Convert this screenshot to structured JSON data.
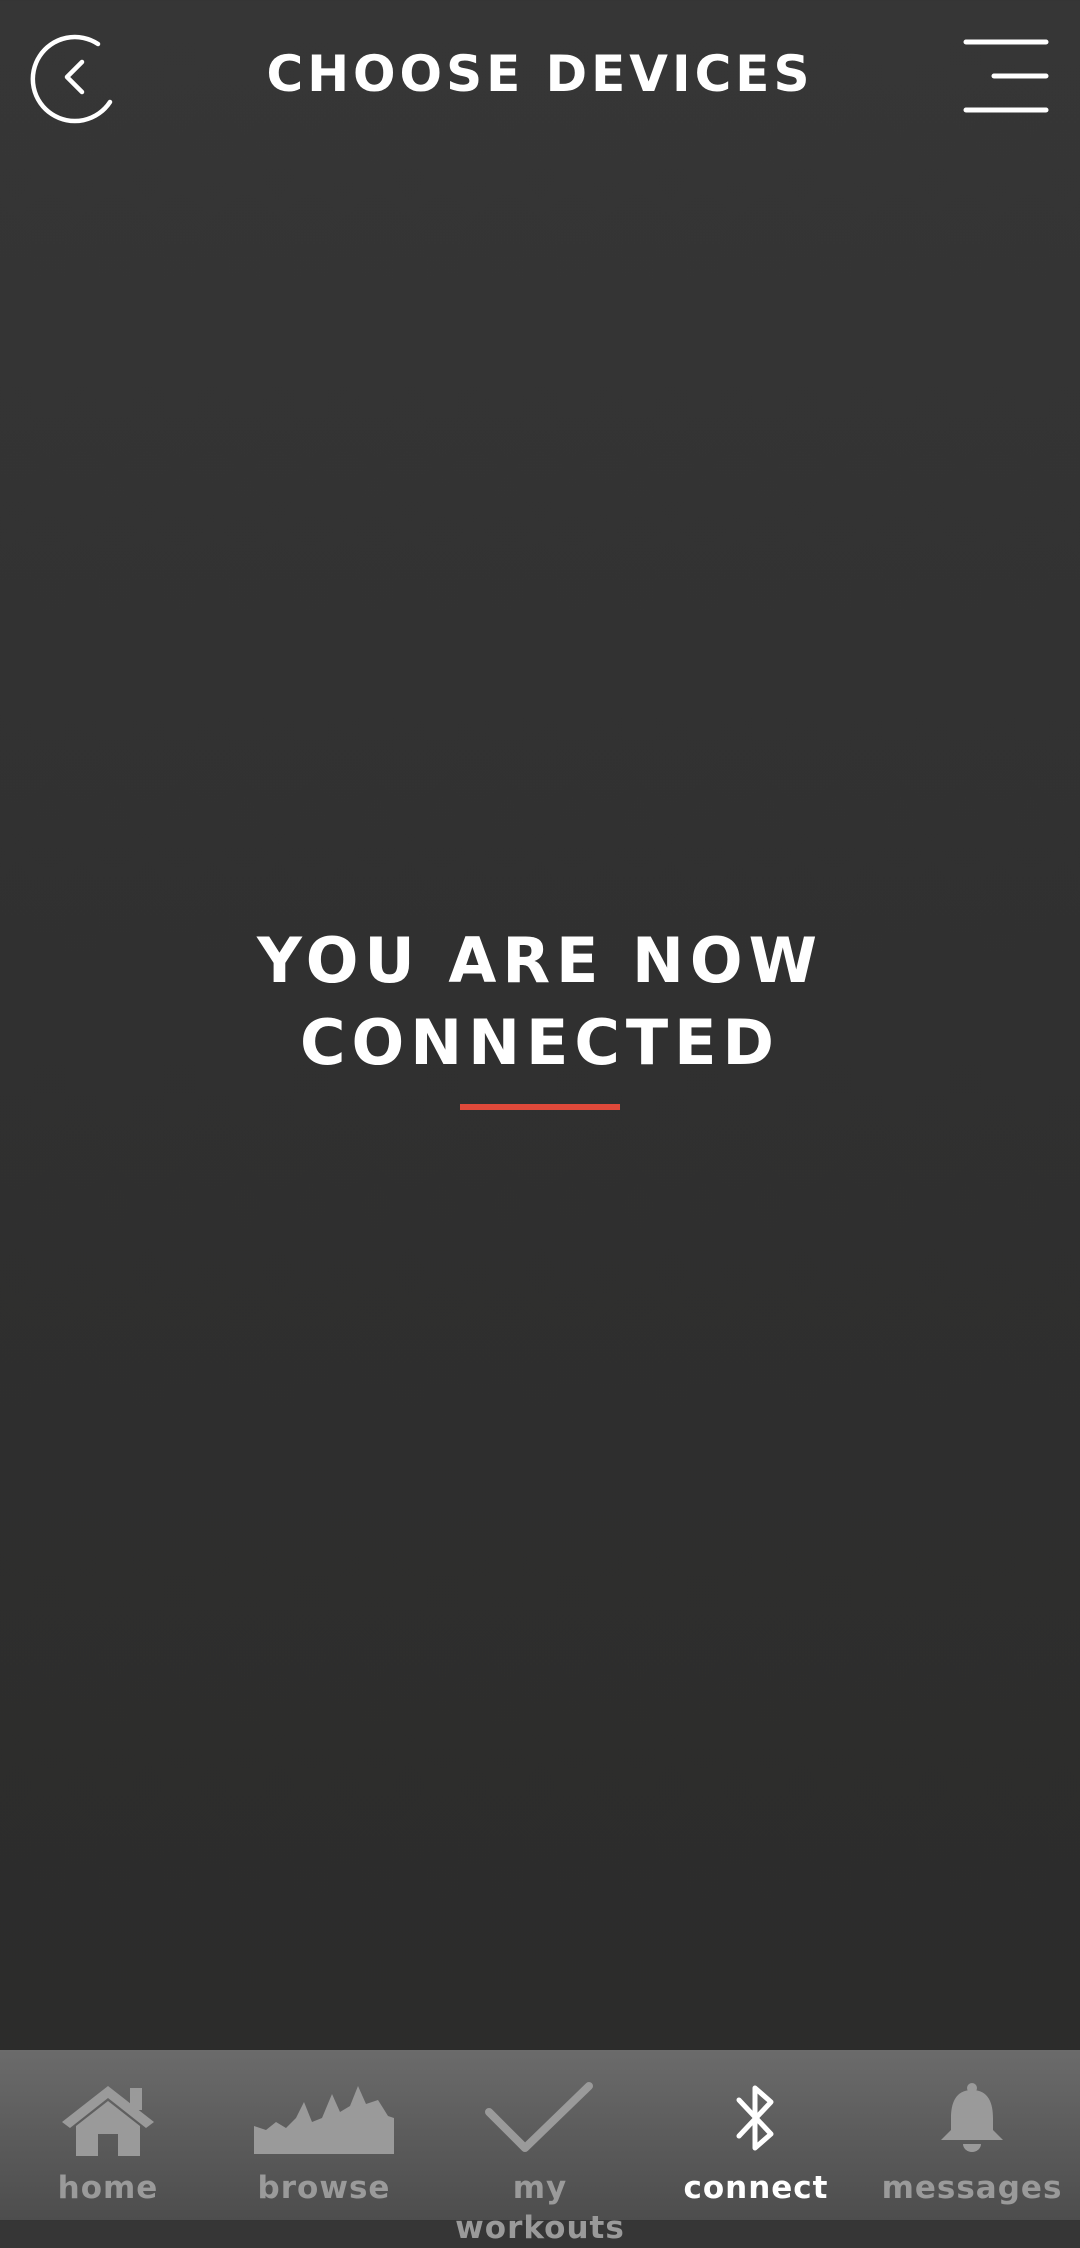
{
  "header": {
    "title": "CHOOSE DEVICES",
    "back_icon": "back-arrow-circle-icon",
    "menu_icon": "hamburger-menu-icon"
  },
  "status": {
    "line1": "YOU ARE NOW",
    "line2": "CONNECTED",
    "accent_color": "#e0493a"
  },
  "tabbar": {
    "active": "connect",
    "tabs": [
      {
        "id": "home",
        "label": "home",
        "icon": "home-icon"
      },
      {
        "id": "browse",
        "label": "browse",
        "icon": "mountain-profile-icon"
      },
      {
        "id": "my-workouts",
        "label": "my workouts",
        "icon": "checkmark-icon"
      },
      {
        "id": "connect",
        "label": "connect",
        "icon": "bluetooth-icon"
      },
      {
        "id": "messages",
        "label": "messages",
        "icon": "bell-icon"
      }
    ]
  },
  "colors": {
    "background": "#333333",
    "tab_inactive": "#9a9a9a",
    "tab_active": "#ffffff"
  }
}
